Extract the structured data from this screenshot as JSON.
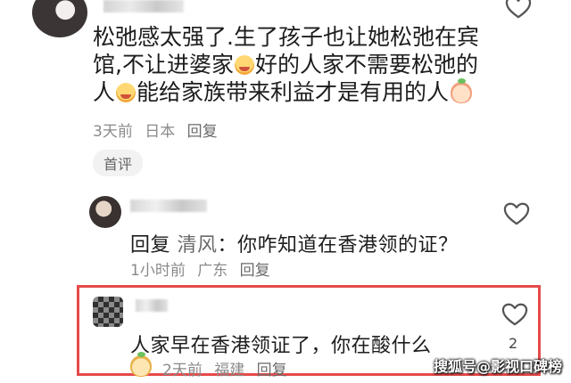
{
  "comment": {
    "text_part1": "松弛感太强了.生了孩子也让她松弛在宾馆,不让进婆家",
    "text_part2": "好的人家不需要松弛的人",
    "text_part3": "能给家族带来利益才是有用的人",
    "time": "3天前",
    "location": "日本",
    "reply_label": "回复"
  },
  "first_comment_pill": "首评",
  "reply1": {
    "prefix": "回复",
    "reply_to": "清风",
    "text": "：你咋知道在香港领的证？",
    "time": "1小时前",
    "location": "广东",
    "reply_label": "回复"
  },
  "reply2": {
    "text": "人家早在香港领证了，你在酸什么",
    "like_count": "2",
    "time": "2天前",
    "location": "福建",
    "reply_label": "回复"
  },
  "watermark": "搜狐号@影视口碑榜",
  "icons": {
    "heart": "heart-outline-icon",
    "emoji_cry": "crying-face-emoji-icon",
    "emoji_peach": "peach-emoji-icon"
  },
  "colors": {
    "highlight": "#e54a4a",
    "meta_text": "#8a8a8a"
  }
}
